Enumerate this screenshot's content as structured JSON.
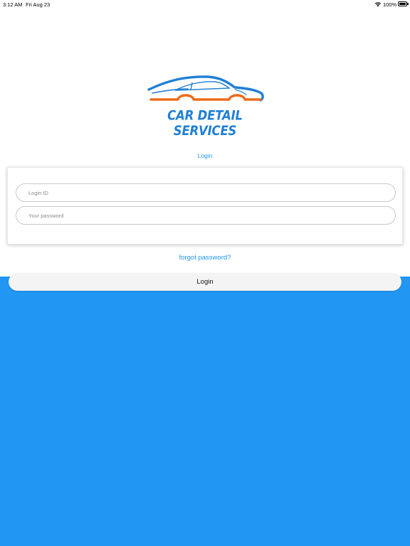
{
  "status_bar": {
    "time": "3:12 AM",
    "date": "Fri Aug 23",
    "battery": "100%",
    "wifi_icon": "wifi-icon",
    "battery_icon": "battery-icon"
  },
  "logo": {
    "text": "CAR DETAIL SERVICES",
    "car_icon": "car-silhouette-icon",
    "colors": {
      "blue": "#1f7fd6",
      "orange": "#ee6a1b"
    }
  },
  "login_heading": "Login",
  "form": {
    "login_id": {
      "value": "",
      "placeholder": "Login ID"
    },
    "password": {
      "value": "",
      "placeholder": "Your password"
    }
  },
  "forgot_password": "forgot password?",
  "login_button": "Login",
  "colors": {
    "accent": "#2196f3",
    "button_bg": "#f4f4f4"
  }
}
